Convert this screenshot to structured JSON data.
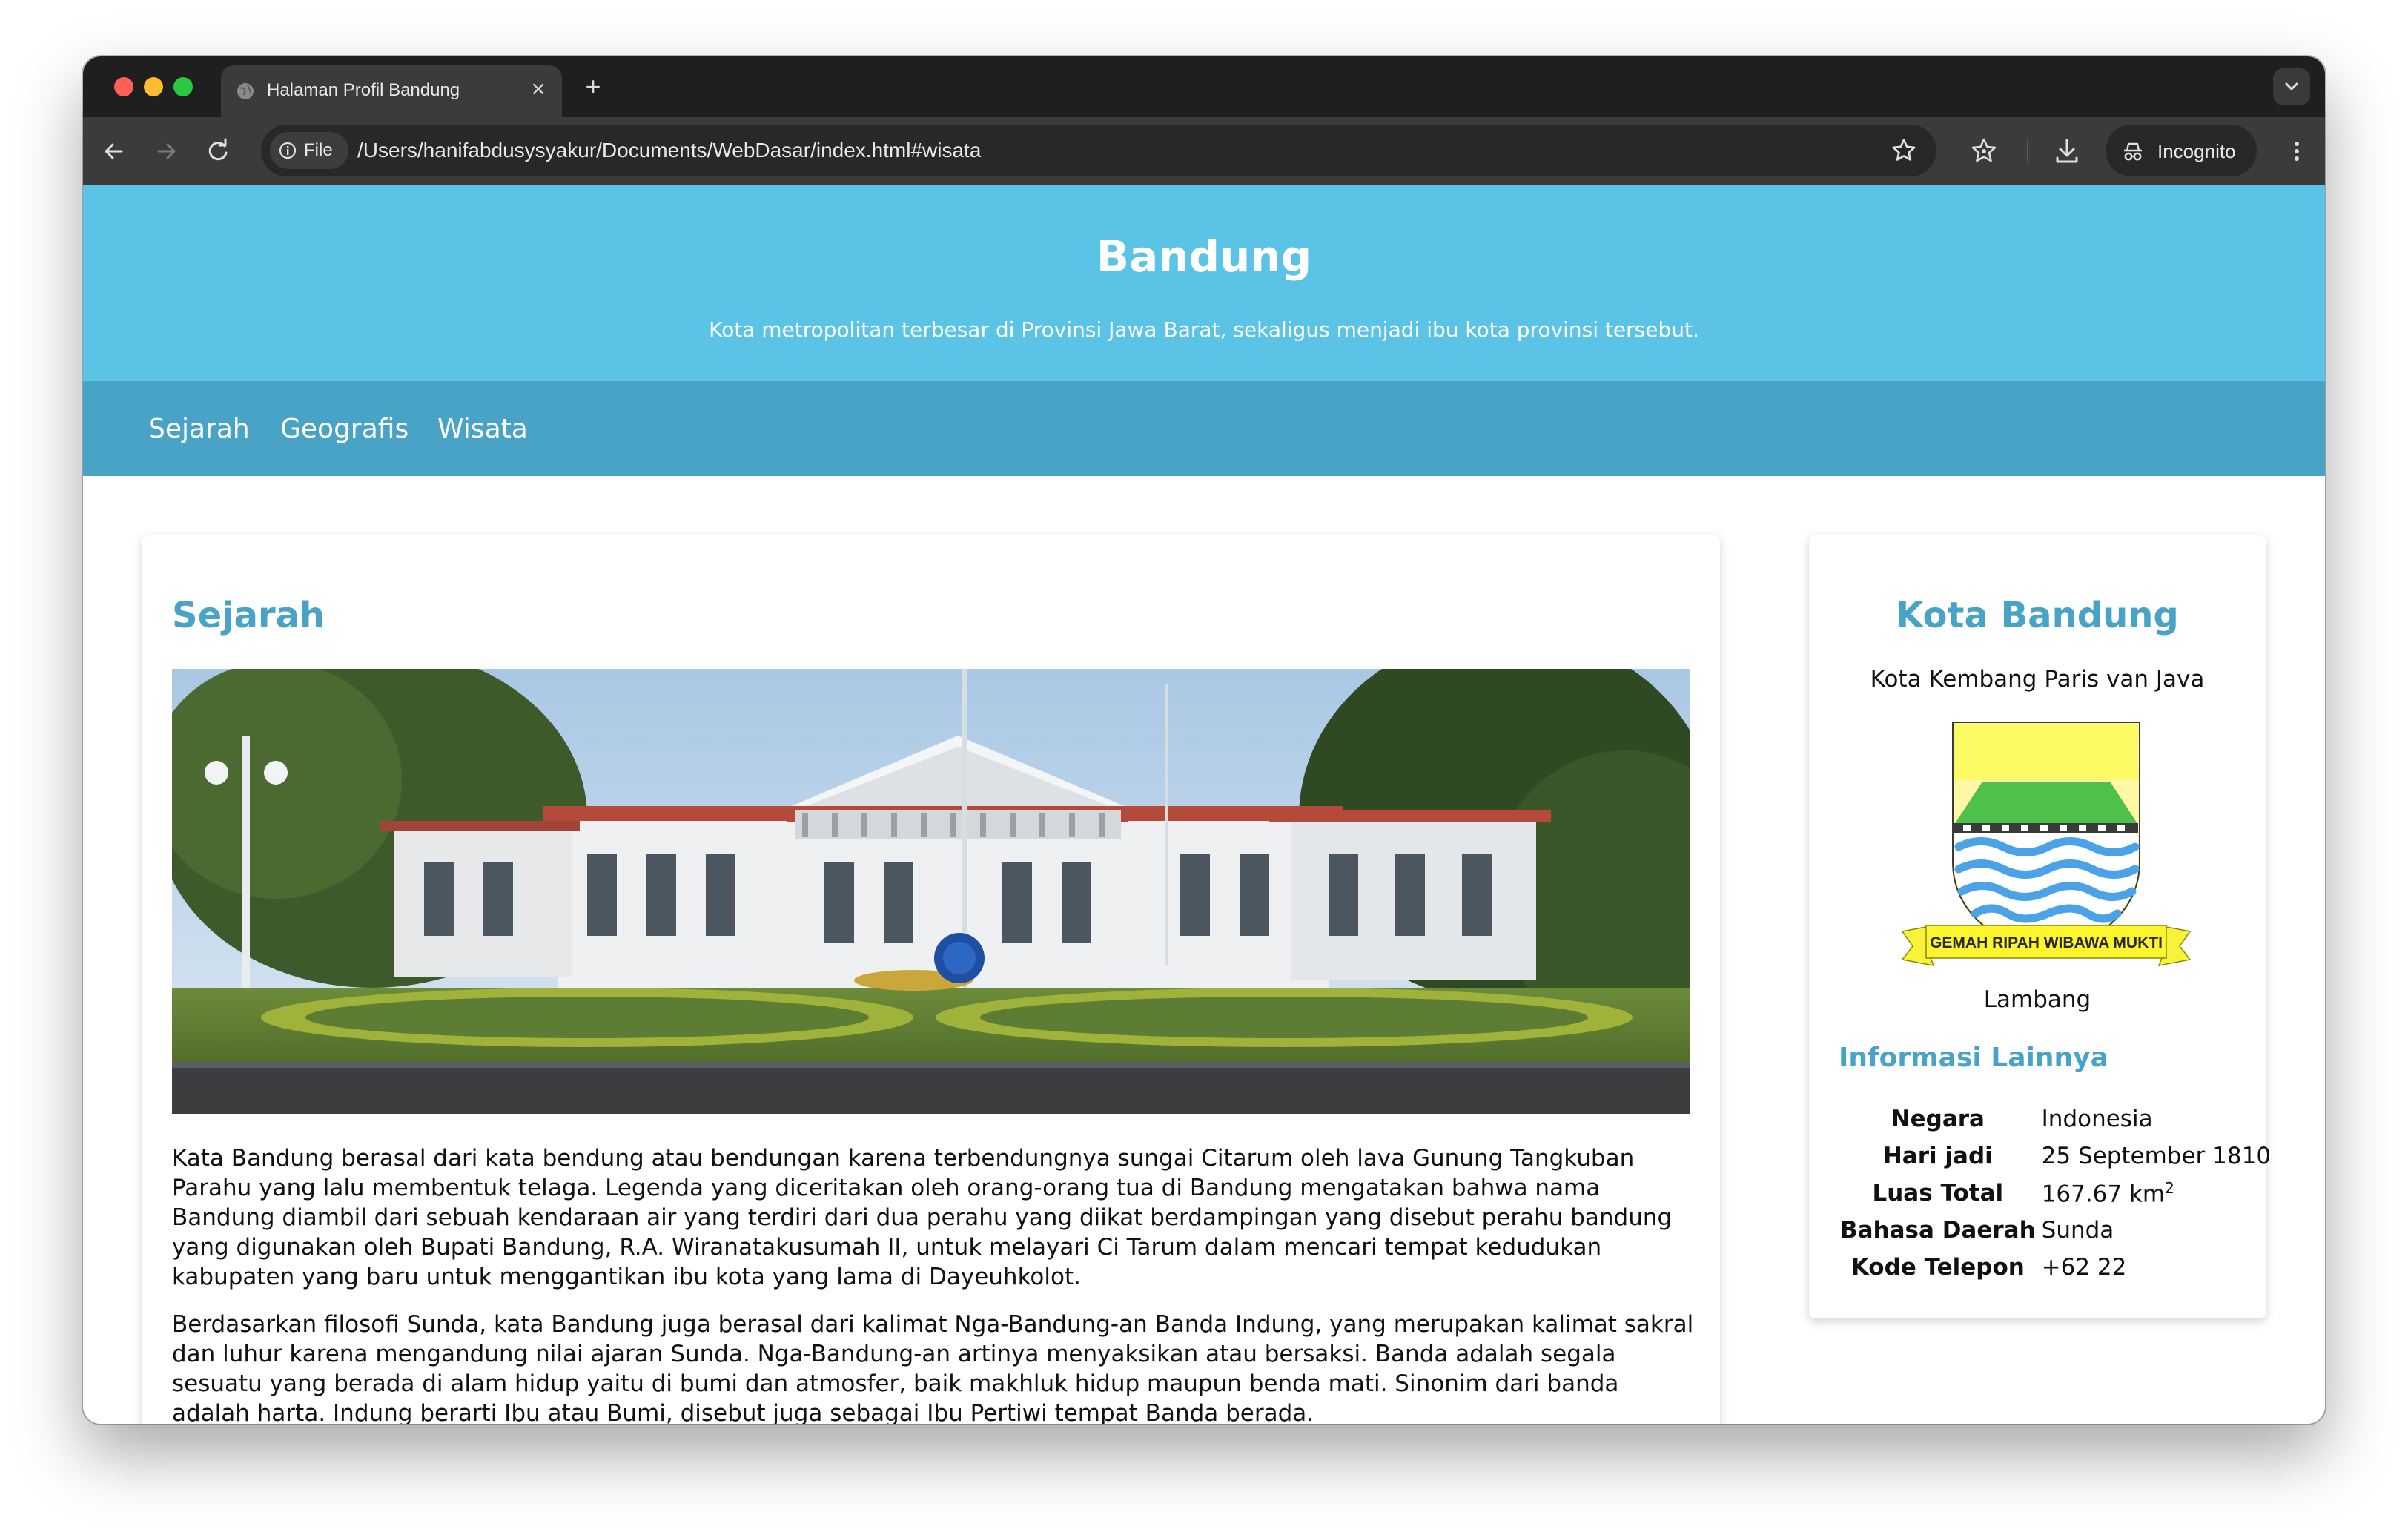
{
  "browser": {
    "tab_title": "Halaman Profil Bandung",
    "tab_close": "×",
    "new_tab": "+",
    "file_chip": "File",
    "url": "/Users/hanifabdusysyakur/Documents/WebDasar/index.html#wisata",
    "incognito_label": "Incognito"
  },
  "header": {
    "title": "Bandung",
    "tagline": "Kota metropolitan terbesar di Provinsi Jawa Barat, sekaligus menjadi ibu kota provinsi tersebut."
  },
  "nav": {
    "items": [
      "Sejarah",
      "Geografis",
      "Wisata"
    ]
  },
  "main": {
    "section_title": "Sejarah",
    "paragraphs": [
      "Kata Bandung berasal dari kata bendung atau bendungan karena terbendungnya sungai Citarum oleh lava Gunung Tangkuban Parahu yang lalu membentuk telaga. Legenda yang diceritakan oleh orang-orang tua di Bandung mengatakan bahwa nama Bandung diambil dari sebuah kendaraan air yang terdiri dari dua perahu yang diikat berdampingan yang disebut perahu bandung yang digunakan oleh Bupati Bandung, R.A. Wiranatakusumah II, untuk melayari Ci Tarum dalam mencari tempat kedudukan kabupaten yang baru untuk menggantikan ibu kota yang lama di Dayeuhkolot.",
      "Berdasarkan filosofi Sunda, kata Bandung juga berasal dari kalimat Nga-Bandung-an Banda Indung, yang merupakan kalimat sakral dan luhur karena mengandung nilai ajaran Sunda. Nga-Bandung-an artinya menyaksikan atau bersaksi. Banda adalah segala sesuatu yang berada di alam hidup yaitu di bumi dan atmosfer, baik makhluk hidup maupun benda mati. Sinonim dari banda adalah harta. Indung berarti Ibu atau Bumi, disebut juga sebagai Ibu Pertiwi tempat Banda berada."
    ]
  },
  "aside": {
    "title": "Kota Bandung",
    "subtitle": "Kota Kembang Paris van Java",
    "emblem_motto": "GEMAH RIPAH WIBAWA MUKTI",
    "emblem_caption": "Lambang",
    "info_title": "Informasi Lainnya",
    "info": {
      "negara_label": "Negara",
      "negara_value": "Indonesia",
      "hari_jadi_label": "Hari jadi",
      "hari_jadi_value": "25 September 1810",
      "luas_label": "Luas Total",
      "luas_value": "167.67 km",
      "luas_sup": "2",
      "bahasa_label": "Bahasa Daerah",
      "bahasa_value": "Sunda",
      "kode_label": "Kode Telepon",
      "kode_value": "+62 22"
    }
  },
  "colors": {
    "header_bg": "#5bc3e6",
    "nav_bg": "#48a3c6",
    "accent": "#48a3c6"
  }
}
